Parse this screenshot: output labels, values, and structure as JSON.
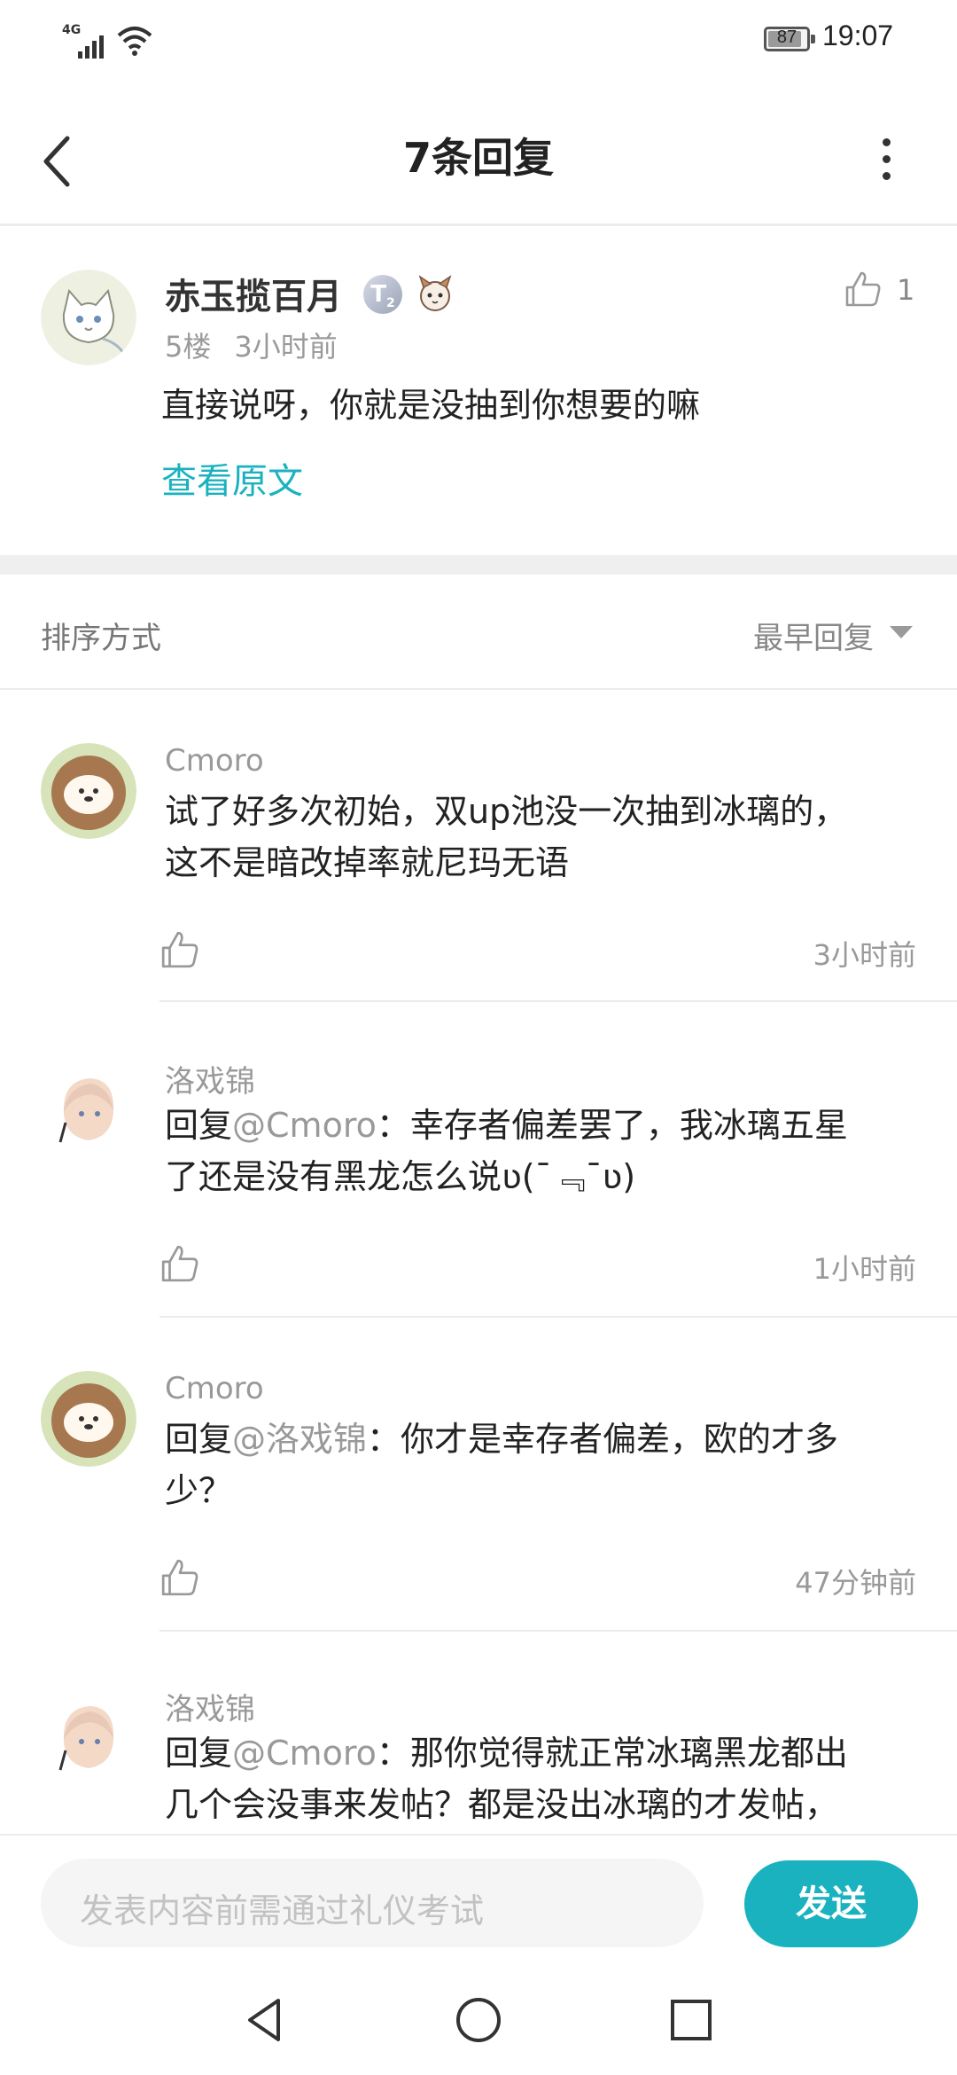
{
  "status_bar": {
    "network": "4G",
    "battery": "87",
    "time": "19:07"
  },
  "header": {
    "title": "7条回复"
  },
  "main_post": {
    "author": "赤玉揽百月",
    "level_badge": "T",
    "level_sub": "2",
    "floor": "5楼",
    "time": "3小时前",
    "likes": "1",
    "content": "直接说呀，你就是没抽到你想要的嘛",
    "view_original": "查看原文"
  },
  "sort": {
    "label": "排序方式",
    "value": "最早回复"
  },
  "replies": [
    {
      "author": "Cmoro",
      "prefix": "",
      "mention": "",
      "text_line1": "试了好多次初始，双up池没一次抽到冰璃的，",
      "text_line2": "这不是暗改掉率就尼玛无语",
      "time": "3小时前"
    },
    {
      "author": "洛戏锦",
      "prefix": "回复",
      "mention": "@Cmoro",
      "text_line1": "：幸存者偏差罢了，我冰璃五星",
      "text_line2": "了还是没有黑龙怎么说ʋ(¯﹃¯ʋ)",
      "time": "1小时前"
    },
    {
      "author": "Cmoro",
      "prefix": "回复",
      "mention": "@洛戏锦",
      "text_line1": "：你才是幸存者偏差，欧的才多",
      "text_line2": "少？",
      "time": "47分钟前"
    },
    {
      "author": "洛戏锦",
      "prefix": "回复",
      "mention": "@Cmoro",
      "text_line1": "：那你觉得就正常冰璃黑龙都出",
      "text_line2": "几个会没事来发帖？都是没出冰璃的才发帖，",
      "time": ""
    }
  ],
  "input": {
    "placeholder": "发表内容前需通过礼仪考试",
    "send_label": "发送"
  },
  "colors": {
    "accent": "#1ab2bf",
    "text": "#222222",
    "muted": "#999999"
  }
}
